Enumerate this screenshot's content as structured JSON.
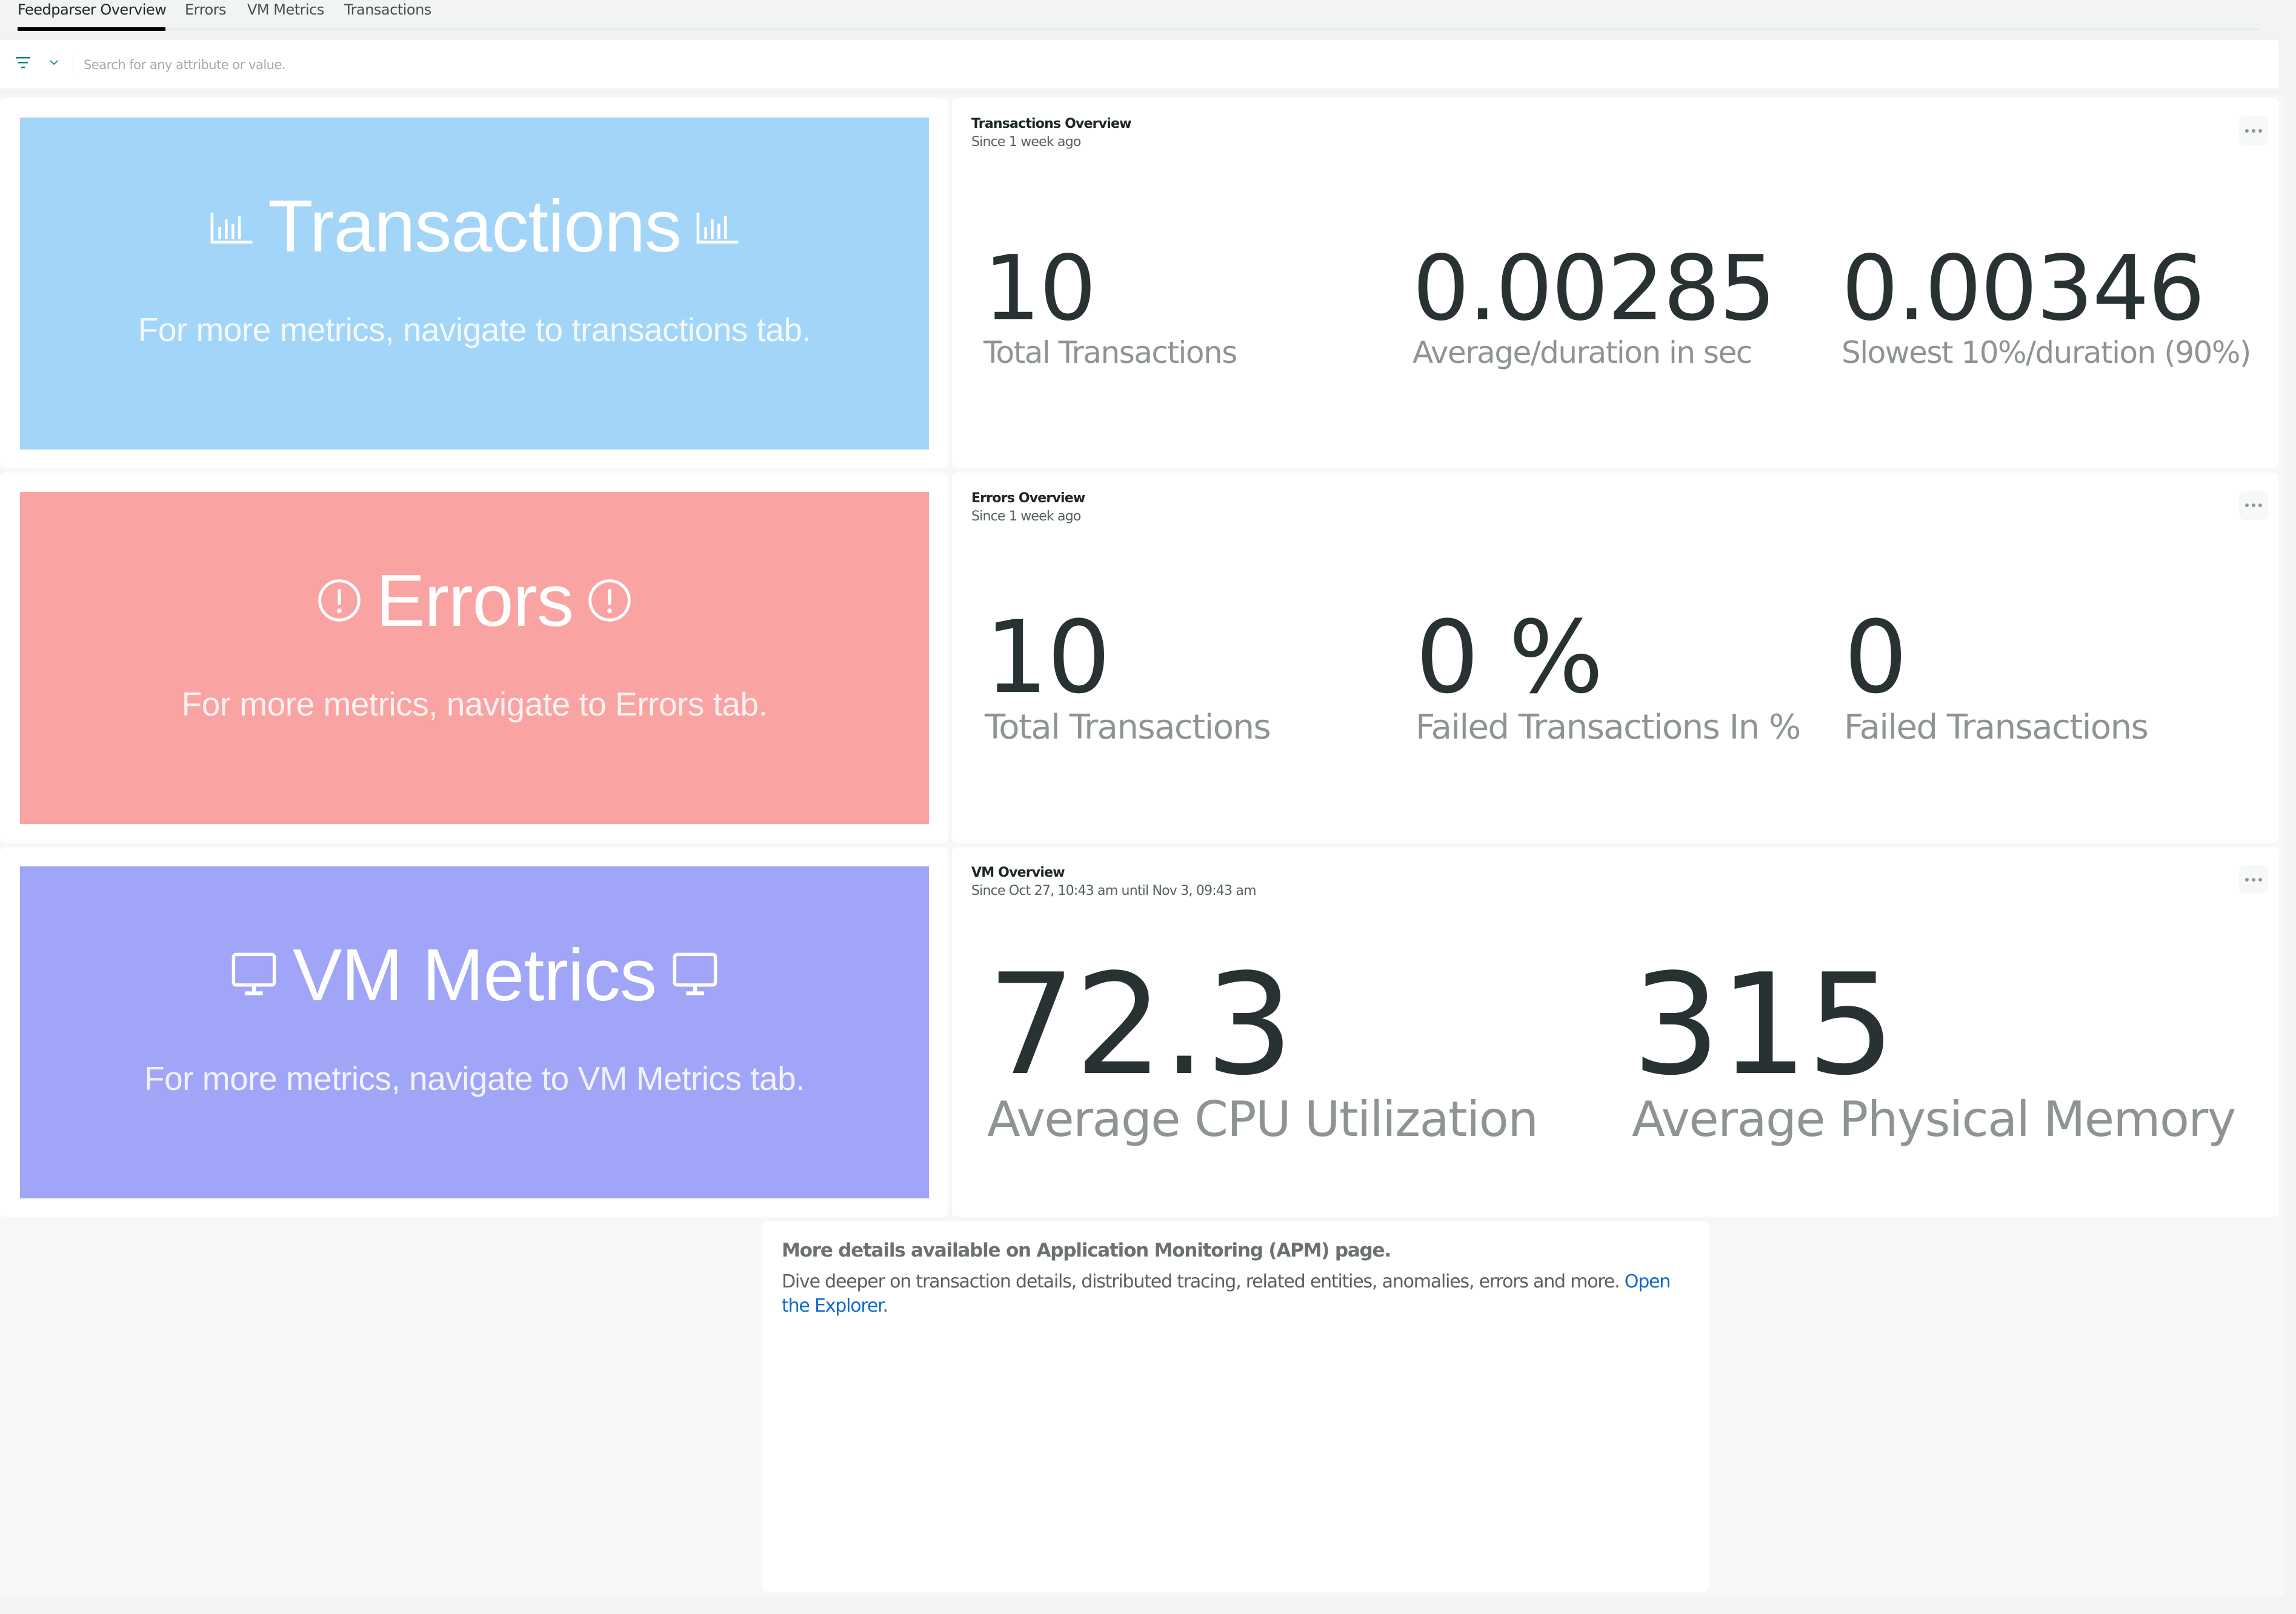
{
  "tabs": [
    {
      "label": "Feedparser Overview",
      "active": true
    },
    {
      "label": "Errors",
      "active": false
    },
    {
      "label": "VM Metrics",
      "active": false
    },
    {
      "label": "Transactions",
      "active": false
    }
  ],
  "search": {
    "placeholder": "Search for any attribute or value.",
    "value": "",
    "filter_icon": "filter-icon",
    "dropdown_icon": "chevron-down-icon"
  },
  "colors": {
    "transactions_banner": "#a3d5f9",
    "errors_banner": "#f9a3a2",
    "vm_banner": "#a1a5f7",
    "link": "#0b6acb",
    "value_text": "#293233",
    "label_text": "#8e9494"
  },
  "rows": [
    {
      "banner": {
        "title": "Transactions",
        "icon": "bar-chart-icon",
        "subtitle": "For more metrics, navigate to transactions tab."
      },
      "widget": {
        "title": "Transactions Overview",
        "subtitle": "Since 1 week ago",
        "menu_icon": "more-horizontal-icon",
        "stats": [
          {
            "value": "10",
            "label": "Total Transactions"
          },
          {
            "value": "0.00285",
            "label": "Average/duration in sec"
          },
          {
            "value": "0.00346",
            "label": "Slowest 10%/duration (90%)"
          }
        ]
      }
    },
    {
      "banner": {
        "title": "Errors",
        "icon": "alert-circle-icon",
        "subtitle": "For more metrics, navigate to Errors tab."
      },
      "widget": {
        "title": "Errors Overview",
        "subtitle": "Since 1 week ago",
        "menu_icon": "more-horizontal-icon",
        "stats": [
          {
            "value": "10",
            "label": "Total Transactions"
          },
          {
            "value": "0 %",
            "label": "Failed Transactions In %"
          },
          {
            "value": "0",
            "label": "Failed Transactions"
          }
        ]
      }
    },
    {
      "banner": {
        "title": "VM Metrics",
        "icon": "monitor-icon",
        "subtitle": "For more metrics, navigate to VM Metrics tab."
      },
      "widget": {
        "title": "VM Overview",
        "subtitle": "Since Oct 27, 10:43 am until Nov 3, 09:43 am",
        "menu_icon": "more-horizontal-icon",
        "stats": [
          {
            "value": "72.3",
            "label": "Average CPU Utilization"
          },
          {
            "value": "315",
            "label": "Average Physical Memory"
          }
        ]
      }
    }
  ],
  "info": {
    "title": "More details available on Application Monitoring (APM) page.",
    "body": "Dive deeper on transaction details, distributed tracing, related entities, anomalies, errors and more. ",
    "link_text": "Open the Explorer",
    "link_suffix": "."
  }
}
